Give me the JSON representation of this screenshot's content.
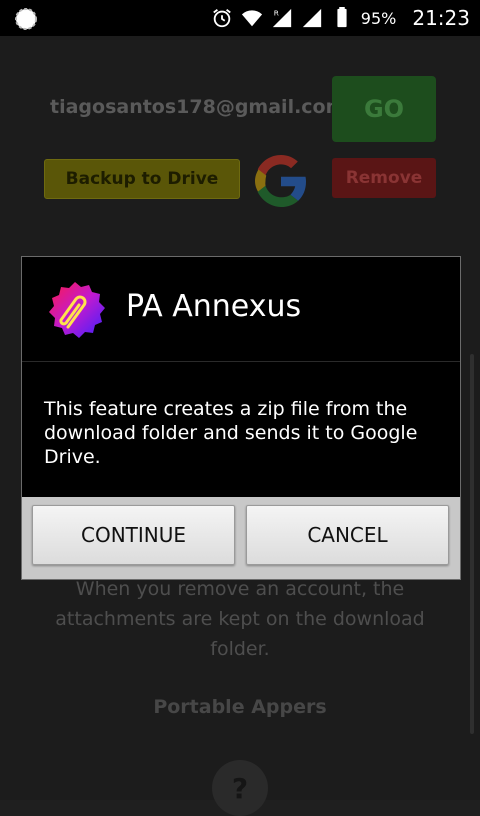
{
  "status_bar": {
    "battery": "95%",
    "time": "21:23"
  },
  "app": {
    "email": "tiagosantos178@gmail.com",
    "go_label": "GO",
    "backup_label": "Backup to Drive",
    "remove_label": "Remove",
    "note_line1": "When you remove an account, the",
    "note_line2": "attachments are kept on the download",
    "note_line3": "folder.",
    "footer": "Portable Appers",
    "help_label": "?"
  },
  "dialog": {
    "title": "PA Annexus",
    "message": "This feature creates a zip file from the download folder and sends it to Google Drive.",
    "continue_label": "CONTINUE",
    "cancel_label": "CANCEL"
  },
  "colors": {
    "go": "#1d4d1d",
    "backup": "#5a5608",
    "remove": "#5a1515",
    "dialog_bg": "#000000"
  }
}
